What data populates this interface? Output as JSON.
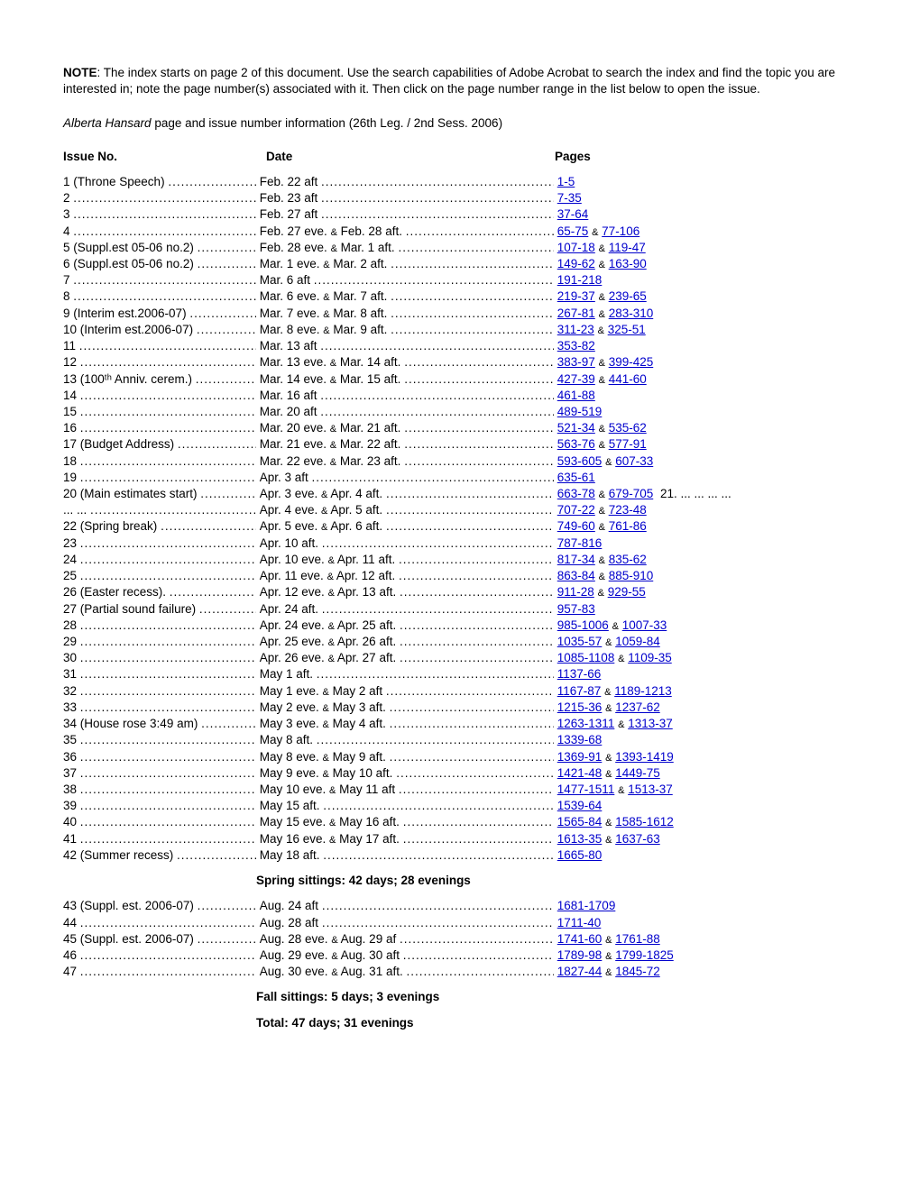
{
  "noteLabel": "NOTE",
  "noteText": ": The index starts on page 2 of this document. Use the search capabilities of Adobe Acrobat to search the index and find the topic you are interested in; note the page number(s) associated with it. Then click on the page number range in the list below to open the issue.",
  "subtitleItalic": "Alberta Hansard",
  "subtitleRest": " page and issue number information (26th Leg. / 2nd Sess. 2006)",
  "hdrIssue": "Issue No.",
  "hdrDate": "Date",
  "hdrPages": "Pages",
  "amp": "&",
  "rows": [
    {
      "issue": "1 (Throne Speech)",
      "date": "Feb. 22 aft",
      "p1": "1-5"
    },
    {
      "issue": "2",
      "date": "Feb. 23 aft",
      "p1": "7-35"
    },
    {
      "issue": "3",
      "date": "Feb. 27 aft",
      "p1": "37-64"
    },
    {
      "issue": "4",
      "date": "Feb. 27 eve.",
      "date2": "Feb. 28 aft.",
      "p1": "65-75",
      "p2": "77-106"
    },
    {
      "issue": "5 (Suppl.est 05-06 no.2)",
      "date": "Feb. 28 eve.",
      "date2": "Mar. 1 aft.",
      "p1": "107-18",
      "p2": "119-47"
    },
    {
      "issue": "6 (Suppl.est 05-06 no.2)",
      "date": "Mar. 1 eve.",
      "date2": "Mar. 2 aft.",
      "p1": "149-62",
      "p2": "163-90"
    },
    {
      "issue": "7",
      "date": "Mar. 6 aft",
      "p1": "191-218"
    },
    {
      "issue": "8",
      "date": "Mar. 6 eve.",
      "date2": "Mar. 7 aft.",
      "p1": "219-37",
      "p2": "239-65"
    },
    {
      "issue": "9 (Interim est.2006-07)",
      "date": "Mar. 7 eve.",
      "date2": "Mar. 8 aft.",
      "p1": "267-81",
      "p2": "283-310"
    },
    {
      "issue": "10 (Interim est.2006-07)",
      "date": "Mar. 8 eve.",
      "date2": "Mar. 9 aft.",
      "p1": "311-23",
      "p2": "325-51"
    },
    {
      "issue": "11",
      "date": "Mar. 13 aft",
      "p1": "353-82"
    },
    {
      "issue": "12",
      "date": "Mar. 13 eve.",
      "date2": "Mar. 14 aft.",
      "p1": "383-97",
      "p2": "399-425"
    },
    {
      "issue": "13 (100ᵗʰ Anniv. cerem.)",
      "date": "Mar. 14 eve.",
      "date2": "Mar. 15 aft.",
      "p1": "427-39",
      "p2": "441-60"
    },
    {
      "issue": "14",
      "date": "Mar. 16 aft",
      "p1": "461-88"
    },
    {
      "issue": "15",
      "date": "Mar. 20 aft",
      "p1": "489-519"
    },
    {
      "issue": "16",
      "date": "Mar. 20 eve.",
      "date2": "Mar. 21 aft.",
      "p1": "521-34",
      "p2": "535-62"
    },
    {
      "issue": "17 (Budget Address)",
      "date": "Mar. 21 eve.",
      "date2": "Mar. 22 aft.",
      "p1": "563-76",
      "p2": "577-91"
    },
    {
      "issue": "18",
      "date": "Mar. 22 eve.",
      "date2": "Mar. 23 aft.",
      "p1": "593-605",
      "p2": "607-33"
    },
    {
      "issue": "19",
      "date": "Apr. 3 aft",
      "p1": "635-61"
    },
    {
      "issue": "20 (Main estimates start)",
      "date": "Apr. 3 eve.",
      "date2": "Apr. 4 aft.",
      "p1": "663-78",
      "p2": "679-705",
      "tail": " 21. ... ... ... ..."
    },
    {
      "issue": "... ...",
      "date": "Apr. 4 eve.",
      "date2": "Apr. 5 aft.",
      "p1": "707-22",
      "p2": "723-48"
    },
    {
      "issue": "22 (Spring break)",
      "date": "Apr. 5 eve.",
      "date2": "Apr. 6 aft.",
      "p1": "749-60",
      "p2": "761-86"
    },
    {
      "issue": "23",
      "date": "Apr. 10 aft.",
      "p1": "787-816"
    },
    {
      "issue": "24",
      "date": "Apr. 10 eve.",
      "date2": "Apr. 11 aft.",
      "p1": "817-34",
      "p2": "835-62"
    },
    {
      "issue": "25",
      "date": "Apr. 11 eve.",
      "date2": "Apr. 12 aft.",
      "p1": "863-84",
      "p2": "885-910"
    },
    {
      "issue": "26 (Easter recess).",
      "date": "Apr. 12 eve.",
      "date2": "Apr. 13 aft.",
      "p1": "911-28",
      "p2": "929-55"
    },
    {
      "issue": "27 (Partial sound failure)",
      "date": "Apr. 24 aft.",
      "p1": "957-83"
    },
    {
      "issue": "28",
      "date": "Apr. 24 eve.",
      "date2": "Apr. 25 aft.",
      "p1": "985-1006",
      "p2": "1007-33"
    },
    {
      "issue": "29",
      "date": "Apr. 25 eve.",
      "date2": "Apr. 26 aft.",
      "p1": "1035-57",
      "p2": "1059-84"
    },
    {
      "issue": "30",
      "date": "Apr. 26 eve.",
      "date2": "Apr. 27 aft.",
      "p1": "1085-1108",
      "p2": "1109-35"
    },
    {
      "issue": "31",
      "date": "May 1 aft.",
      "p1": "1137-66"
    },
    {
      "issue": "32",
      "date": "May 1 eve.",
      "date2": "May 2 aft",
      "p1": "1167-87",
      "p2": "1189-1213"
    },
    {
      "issue": "33",
      "date": "May 2 eve.",
      "date2": "May 3 aft.",
      "p1": "1215-36",
      "p2": "1237-62"
    },
    {
      "issue": "34 (House rose 3:49 am)",
      "date": "May 3 eve.",
      "date2": "May 4 aft.",
      "p1": "1263-1311",
      "p2": "1313-37"
    },
    {
      "issue": "35",
      "date": "May 8 aft.",
      "p1": "1339-68"
    },
    {
      "issue": "36",
      "date": "May 8 eve.",
      "date2": "May 9 aft.",
      "p1": "1369-91",
      "p2": "1393-1419"
    },
    {
      "issue": "37",
      "date": "May 9 eve.",
      "date2": "May 10 aft.",
      "p1": "1421-48",
      "p2": "1449-75"
    },
    {
      "issue": "38",
      "date": "May 10 eve.",
      "date2": "May 11 aft",
      "p1": "1477-1511",
      "p2": "1513-37"
    },
    {
      "issue": "39",
      "date": "May 15 aft.",
      "p1": "1539-64"
    },
    {
      "issue": "40",
      "date": "May 15 eve.",
      "date2": "May 16 aft.",
      "p1": "1565-84",
      "p2": "1585-1612"
    },
    {
      "issue": "41",
      "date": "May 16 eve.",
      "date2": "May 17 aft.",
      "p1": "1613-35",
      "p2": "1637-63"
    },
    {
      "issue": "42 (Summer recess)",
      "date": "May 18 aft.",
      "p1": "1665-80"
    }
  ],
  "springSummary": "Spring sittings: 42 days; 28 evenings",
  "rows2": [
    {
      "issue": "43 (Suppl. est. 2006-07)",
      "date": "Aug. 24 aft",
      "p1": "1681-1709"
    },
    {
      "issue": "44",
      "date": "Aug. 28 aft",
      "p1": "1711-40"
    },
    {
      "issue": "45 (Suppl. est. 2006-07)",
      "date": "Aug. 28 eve.",
      "date2": "Aug. 29 af",
      "p1": "1741-60",
      "p2": "1761-88"
    },
    {
      "issue": "46",
      "date": "Aug. 29 eve.",
      "date2": "Aug. 30 aft",
      "p1": "1789-98",
      "p2": "1799-1825"
    },
    {
      "issue": "47",
      "date": "Aug. 30 eve.",
      "date2": "Aug. 31 aft.",
      "p1": "1827-44",
      "p2": "1845-72"
    }
  ],
  "fallSummary": "Fall sittings: 5 days; 3 evenings",
  "totalSummary": "Total: 47 days; 31 evenings"
}
